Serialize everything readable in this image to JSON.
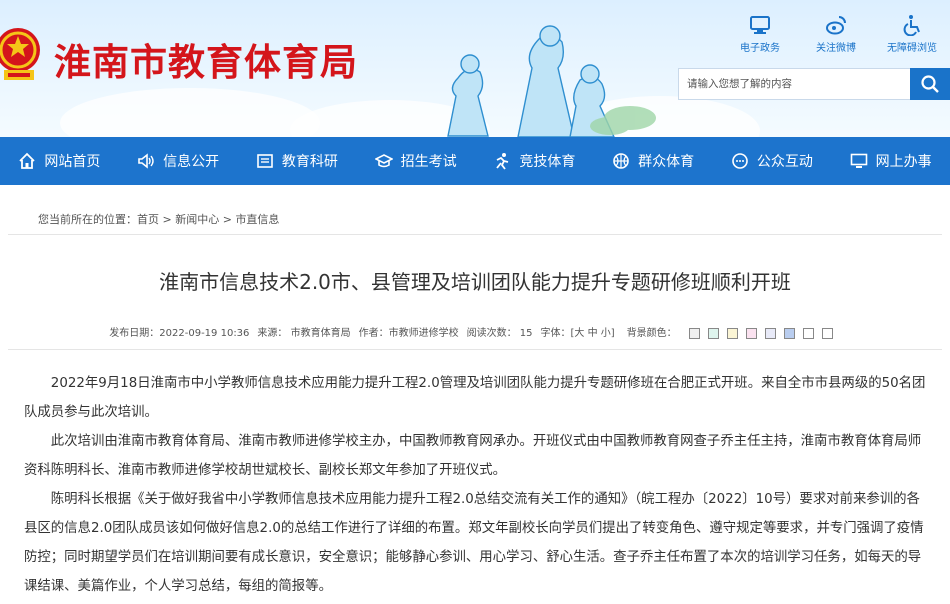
{
  "header": {
    "site_title": "淮南市教育体育局",
    "top_links": [
      {
        "label": "电子政务",
        "icon": "monitor-icon"
      },
      {
        "label": "关注微博",
        "icon": "weibo-icon"
      },
      {
        "label": "无障碍浏览",
        "icon": "wheelchair-icon"
      }
    ],
    "search_placeholder": "请输入您想了解的内容"
  },
  "nav": {
    "items": [
      {
        "label": "网站首页",
        "icon": "home-icon"
      },
      {
        "label": "信息公开",
        "icon": "speaker-icon"
      },
      {
        "label": "教育科研",
        "icon": "book-icon"
      },
      {
        "label": "招生考试",
        "icon": "graduation-cap-icon"
      },
      {
        "label": "竞技体育",
        "icon": "runner-icon"
      },
      {
        "label": "群众体育",
        "icon": "basketball-icon"
      },
      {
        "label": "公众互动",
        "icon": "chat-icon"
      },
      {
        "label": "网上办事",
        "icon": "computer-icon"
      }
    ]
  },
  "breadcrumb": {
    "prefix": "您当前所在的位置：",
    "items": [
      "首页",
      "新闻中心",
      "市直信息"
    ],
    "separator": " > "
  },
  "article": {
    "title": "淮南市信息技术2.0市、县管理及培训团队能力提升专题研修班顺利开班",
    "meta": {
      "published": "发布日期：2022-09-19 10:36",
      "source": "来源：  市教育体育局",
      "author": "作者：市教师进修学校",
      "views": "阅读次数：  15",
      "font_size": "字体：[大 中 小]",
      "bg_color_label": "背景颜色：",
      "bg_colors": [
        "#f0f0f0",
        "#dff5ee",
        "#fbf5d5",
        "#fbe2f0",
        "#e8eaf8",
        "#b9cdef",
        "#ffffff",
        "#ffffff"
      ]
    },
    "paragraphs": [
      "2022年9月18日淮南市中小学教师信息技术应用能力提升工程2.0管理及培训团队能力提升专题研修班在合肥正式开班。来自全市市县两级的50名团队成员参与此次培训。",
      "此次培训由淮南市教育体育局、淮南市教师进修学校主办，中国教师教育网承办。开班仪式由中国教师教育网查子乔主任主持，淮南市教育体育局师资科陈明科长、淮南市教师进修学校胡世斌校长、副校长郑文年参加了开班仪式。",
      "陈明科长根据《关于做好我省中小学教师信息技术应用能力提升工程2.0总结交流有关工作的通知》（皖工程办〔2022〕10号）要求对前来参训的各县区的信息2.0团队成员该如何做好信息2.0的总结工作进行了详细的布置。郑文年副校长向学员们提出了转变角色、遵守规定等要求，并专门强调了疫情防控；同时期望学员们在培训期间要有成长意识，安全意识；能够静心参训、用心学习、舒心生活。查子乔主任布置了本次的培训学习任务，如每天的导课结课、美篇作业，个人学习总结，每组的简报等。"
    ]
  }
}
